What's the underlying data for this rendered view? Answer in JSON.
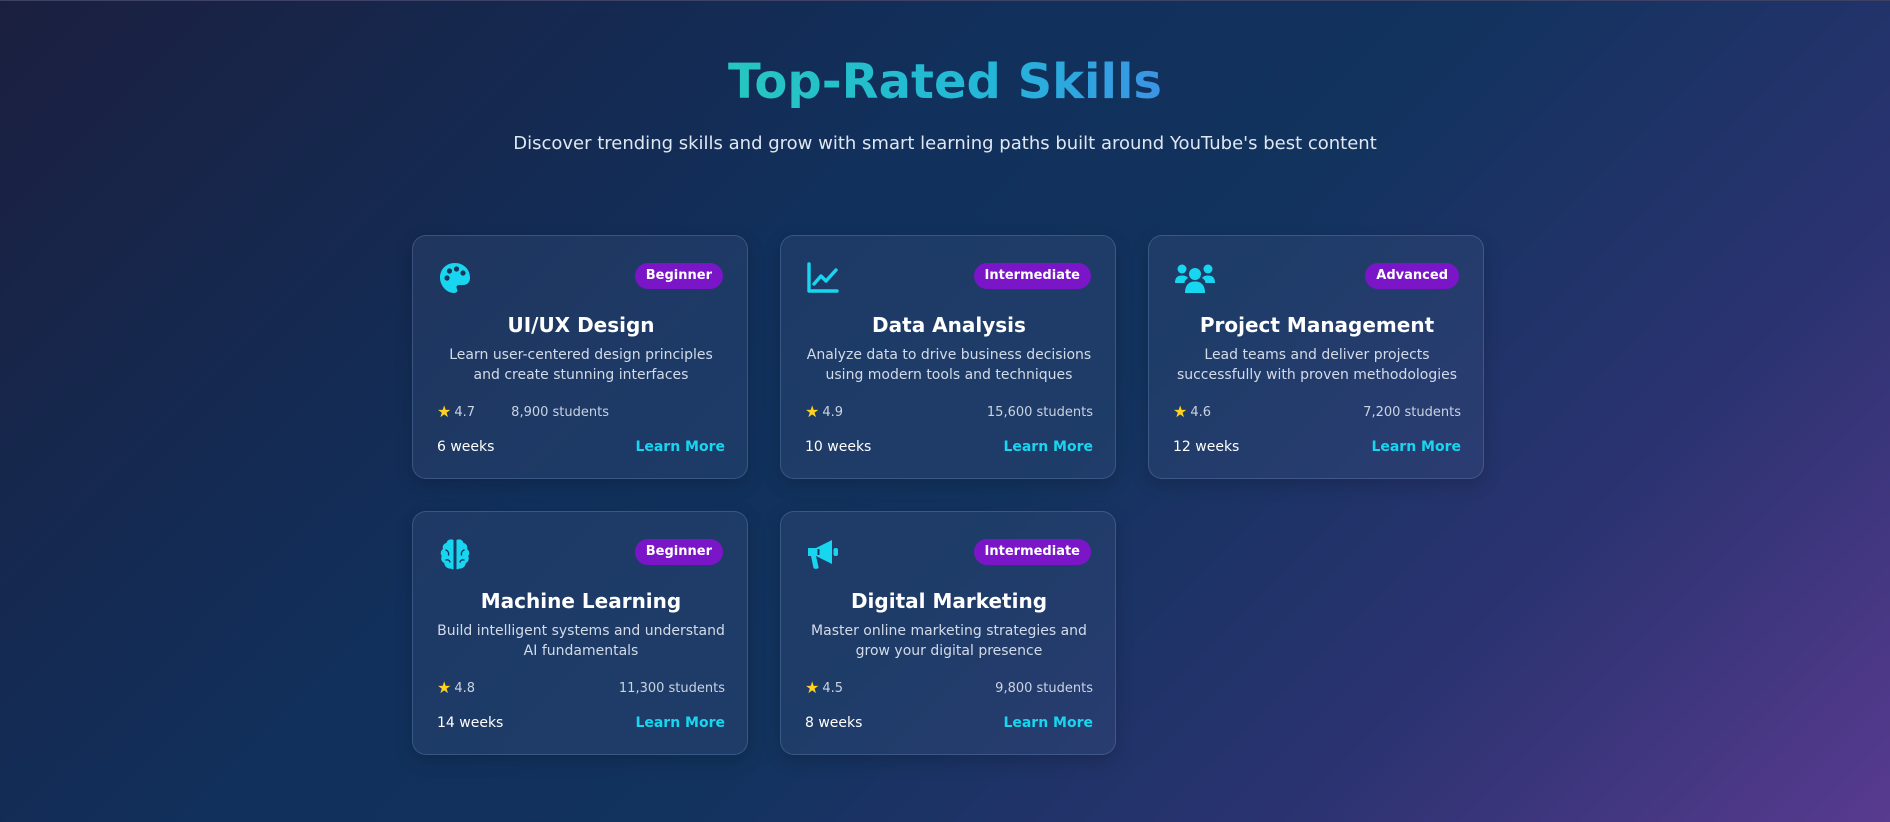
{
  "header": {
    "title": "Top-Rated Skills",
    "subtitle": "Discover trending skills and grow with smart learning paths built around YouTube's best content"
  },
  "colors": {
    "title_gradient_start": "#26c6c0",
    "title_gradient_end": "#3b94e5",
    "badge_background": "#7b16c8",
    "accent_link": "#18d6f0",
    "star": "#ffd21f",
    "icon": "#18d6f0"
  },
  "cards": [
    {
      "icon": "palette-icon",
      "level": "Beginner",
      "title": "UI/UX Design",
      "description": "Learn user-centered design principles and create stunning interfaces",
      "rating": "4.7",
      "students": "8,900 students",
      "duration": "6 weeks",
      "cta": "Learn More"
    },
    {
      "icon": "chart-line-icon",
      "level": "Intermediate",
      "title": "Data Analysis",
      "description": "Analyze data to drive business decisions using modern tools and techniques",
      "rating": "4.9",
      "students": "15,600 students",
      "duration": "10 weeks",
      "cta": "Learn More"
    },
    {
      "icon": "users-icon",
      "level": "Advanced",
      "title": "Project Management",
      "description": "Lead teams and deliver projects successfully with proven methodologies",
      "rating": "4.6",
      "students": "7,200 students",
      "duration": "12 weeks",
      "cta": "Learn More"
    },
    {
      "icon": "brain-icon",
      "level": "Beginner",
      "title": "Machine Learning",
      "description": "Build intelligent systems and understand AI fundamentals",
      "rating": "4.8",
      "students": "11,300 students",
      "duration": "14 weeks",
      "cta": "Learn More"
    },
    {
      "icon": "megaphone-icon",
      "level": "Intermediate",
      "title": "Digital Marketing",
      "description": "Master online marketing strategies and grow your digital presence",
      "rating": "4.5",
      "students": "9,800 students",
      "duration": "8 weeks",
      "cta": "Learn More"
    }
  ]
}
